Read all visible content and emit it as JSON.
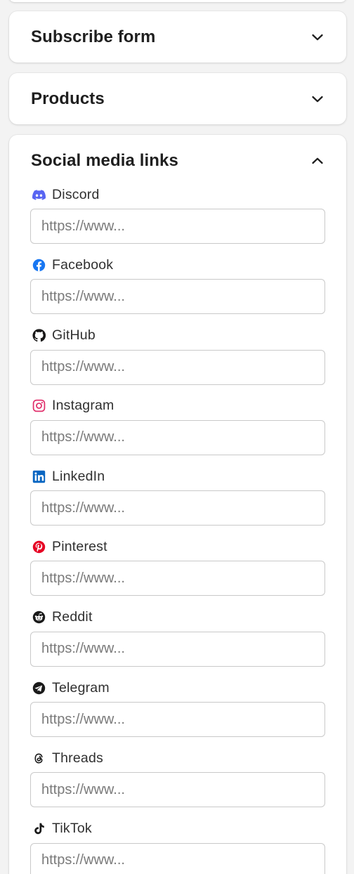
{
  "sections": {
    "subscribe": {
      "title": "Subscribe form"
    },
    "products": {
      "title": "Products"
    },
    "social": {
      "title": "Social media links"
    }
  },
  "social_links": [
    {
      "label": "Discord",
      "icon": "discord-icon",
      "placeholder": "https://www...",
      "color": "#5865f2"
    },
    {
      "label": "Facebook",
      "icon": "facebook-icon",
      "placeholder": "https://www...",
      "color": "#1877f2"
    },
    {
      "label": "GitHub",
      "icon": "github-icon",
      "placeholder": "https://www...",
      "color": "#181717"
    },
    {
      "label": "Instagram",
      "icon": "instagram-icon",
      "placeholder": "https://www...",
      "color": "#e1306c"
    },
    {
      "label": "LinkedIn",
      "icon": "linkedin-icon",
      "placeholder": "https://www...",
      "color": "#0a66c2"
    },
    {
      "label": "Pinterest",
      "icon": "pinterest-icon",
      "placeholder": "https://www...",
      "color": "#e60023"
    },
    {
      "label": "Reddit",
      "icon": "reddit-icon",
      "placeholder": "https://www...",
      "color": "#1a1a1a"
    },
    {
      "label": "Telegram",
      "icon": "telegram-icon",
      "placeholder": "https://www...",
      "color": "#1a1a1a"
    },
    {
      "label": "Threads",
      "icon": "threads-icon",
      "placeholder": "https://www...",
      "color": "#1a1a1a"
    },
    {
      "label": "TikTok",
      "icon": "tiktok-icon",
      "placeholder": "https://www...",
      "color": "#1a1a1a"
    }
  ]
}
